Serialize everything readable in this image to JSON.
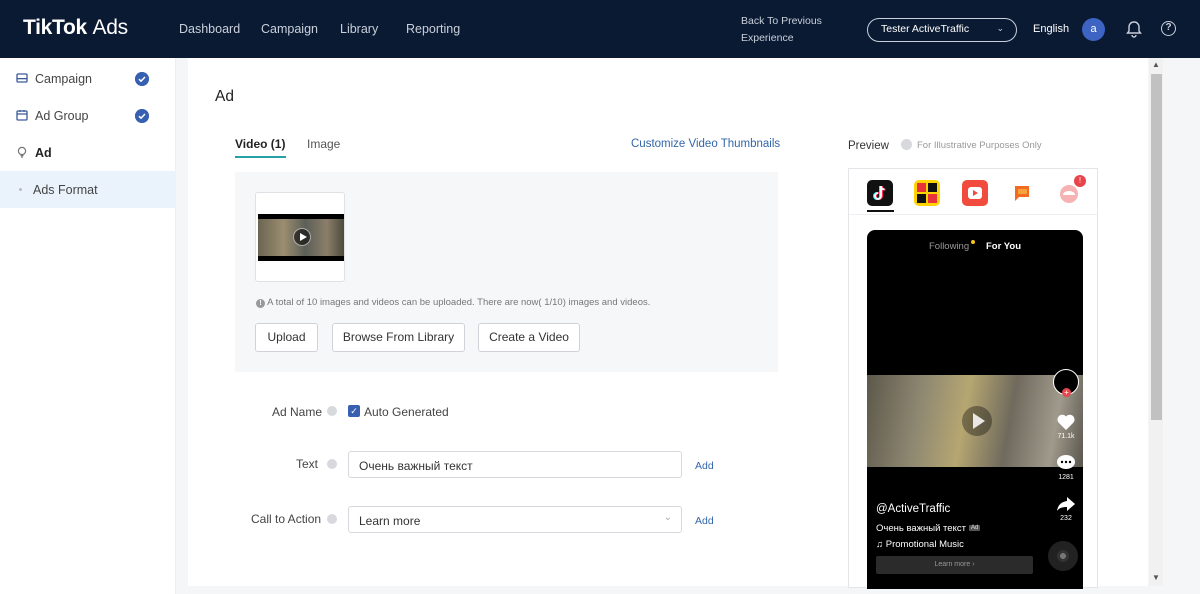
{
  "header": {
    "logo_main": "TikTok",
    "logo_sub": "Ads",
    "nav": [
      "Dashboard",
      "Campaign",
      "Library",
      "Reporting"
    ],
    "back_link": "Back To Previous Experience",
    "account": "Tester ActiveTraffic",
    "language": "English",
    "avatar_letter": "a"
  },
  "sidebar": {
    "items": [
      {
        "label": "Campaign",
        "icon": "campaign-icon",
        "done": true
      },
      {
        "label": "Ad Group",
        "icon": "calendar-icon",
        "done": true
      },
      {
        "label": "Ad",
        "icon": "bulb-icon",
        "done": false
      },
      {
        "label": "Ads Format",
        "icon": "",
        "done": false
      }
    ]
  },
  "main": {
    "title": "Ad",
    "tabs": [
      "Video (1)",
      "Image"
    ],
    "customize_link": "Customize Video Thumbnails",
    "upload_note": "A total of 10 images and videos can be uploaded. There are now( 1/10) images and videos.",
    "buttons": {
      "upload": "Upload",
      "browse": "Browse From Library",
      "create": "Create a Video"
    },
    "ad_name_label": "Ad Name",
    "auto_generated": "Auto Generated",
    "text_label": "Text",
    "text_value": "Очень важный текст",
    "cta_label": "Call to Action",
    "cta_value": "Learn more",
    "add_label": "Add"
  },
  "preview": {
    "label": "Preview",
    "note": "For Illustrative Purposes Only",
    "apps": [
      "tiktok-icon",
      "topbuzz-icon",
      "vigo-icon",
      "newsrepublic-icon",
      "babe-icon"
    ],
    "badge": "!",
    "phone": {
      "following": "Following",
      "for_you": "For You",
      "likes": "71.1k",
      "comments": "1281",
      "shares": "232",
      "handle": "@ActiveTraffic",
      "caption": "Очень важный текст",
      "ad_tag": "Ad",
      "music": "♫ Promotional Music",
      "cta": "Learn more ›"
    }
  },
  "colors": {
    "topbar": "#0b1a33",
    "accent": "#3860b0",
    "tab_underline": "#25a0a5",
    "link": "#3366aa"
  }
}
